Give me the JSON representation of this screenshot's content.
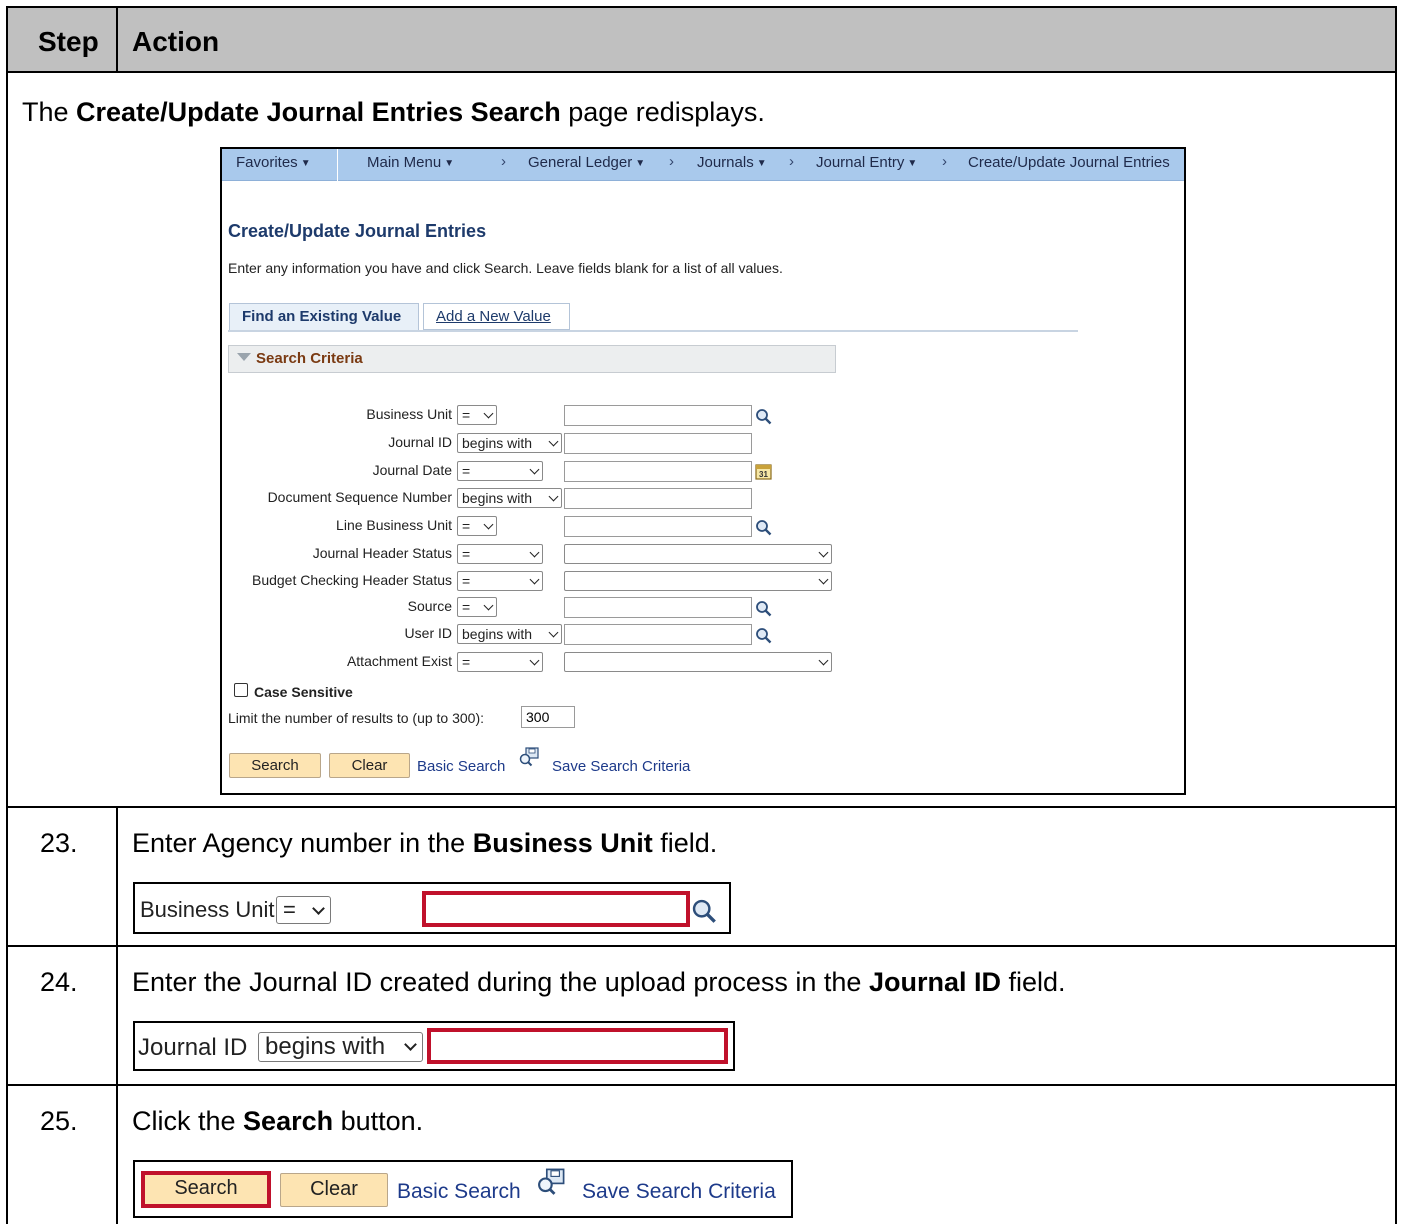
{
  "header": {
    "step": "Step",
    "action": "Action"
  },
  "intro": {
    "prefix": "The ",
    "bold": "Create/Update Journal Entries Search",
    "suffix": " page redisplays."
  },
  "nav": {
    "favorites": "Favorites",
    "main_menu": "Main Menu",
    "general_ledger": "General Ledger",
    "journals": "Journals",
    "journal_entry": "Journal Entry",
    "current": "Create/Update Journal Entries"
  },
  "page": {
    "title": "Create/Update Journal Entries",
    "instructions": "Enter any information you have and click Search. Leave fields blank for a list of all values.",
    "tab_find": "Find an Existing Value",
    "tab_add": "Add a New Value",
    "search_criteria": "Search Criteria",
    "fields": [
      {
        "label": "Business Unit",
        "operator": "=",
        "control": "input",
        "lookup": "magnifier"
      },
      {
        "label": "Journal ID",
        "operator": "begins with",
        "control": "input"
      },
      {
        "label": "Journal Date",
        "operator": "=",
        "control": "input",
        "lookup": "calendar"
      },
      {
        "label": "Document Sequence Number",
        "operator": "begins with",
        "control": "input"
      },
      {
        "label": "Line Business Unit",
        "operator": "=",
        "control": "input",
        "lookup": "magnifier"
      },
      {
        "label": "Journal Header Status",
        "operator": "=",
        "control": "select"
      },
      {
        "label": "Budget Checking Header Status",
        "operator": "=",
        "control": "select"
      },
      {
        "label": "Source",
        "operator": "=",
        "control": "input",
        "lookup": "magnifier"
      },
      {
        "label": "User ID",
        "operator": "begins with",
        "control": "input",
        "lookup": "magnifier"
      },
      {
        "label": "Attachment Exist",
        "operator": "=",
        "control": "select"
      }
    ],
    "case_sensitive": "Case Sensitive",
    "limit_label": "Limit the number of results to (up to 300):",
    "limit_value": "300",
    "buttons": {
      "search": "Search",
      "clear": "Clear"
    },
    "links": {
      "basic_search": "Basic Search",
      "save_search": "Save Search Criteria"
    }
  },
  "steps": [
    {
      "num": "23.",
      "pre": "Enter Agency number in the ",
      "bold": "Business Unit",
      "post": " field.",
      "crop_label": "Business Unit",
      "crop_operator": "="
    },
    {
      "num": "24.",
      "pre": "Enter the Journal ID created during the upload process in the ",
      "bold": "Journal ID",
      "post": " field.",
      "crop_label": "Journal ID",
      "crop_operator": "begins with"
    },
    {
      "num": "25.",
      "pre": "Click the ",
      "bold": "Search",
      "post": " button.",
      "crop_search": "Search",
      "crop_clear": "Clear",
      "crop_basic": "Basic Search",
      "crop_save": "Save Search Criteria"
    }
  ],
  "colors": {
    "highlight": "#c0112b",
    "button_fill": "#fde4b2",
    "nav_bar": "#a9c9ec",
    "title_blue": "#1d3a6b"
  },
  "icons": [
    "lookup-magnifier-icon",
    "calendar-icon",
    "save-search-icon",
    "collapse-triangle-icon",
    "dropdown-caret-icon"
  ]
}
